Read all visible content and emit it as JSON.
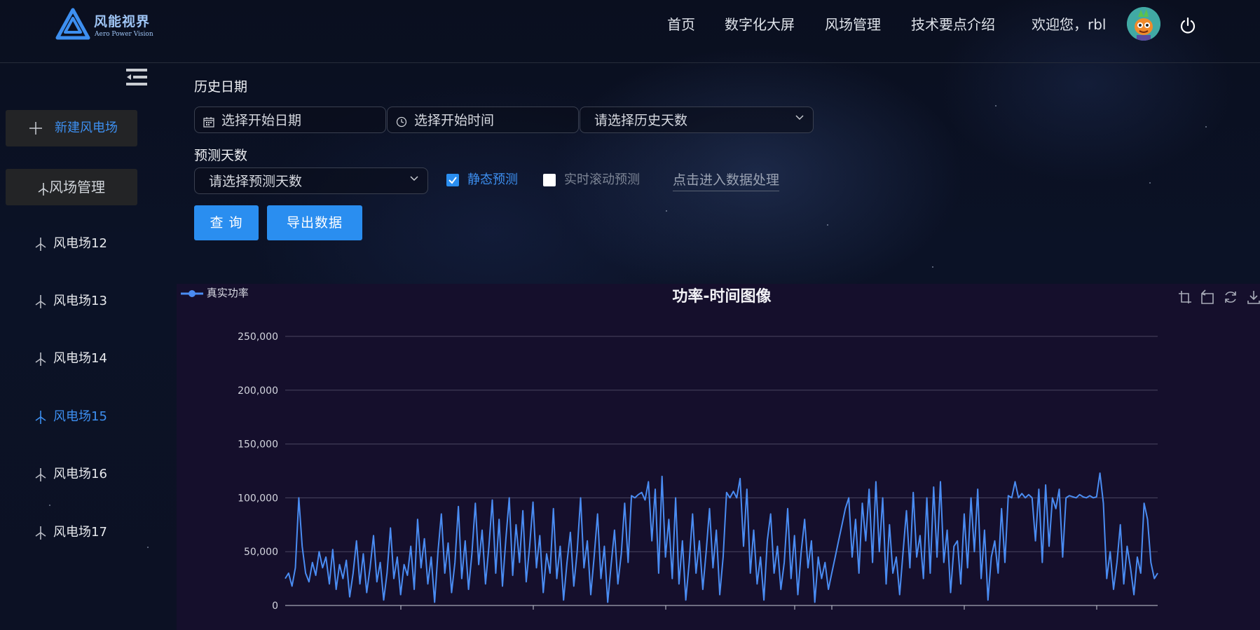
{
  "header": {
    "logo_title": "风能视界",
    "logo_subtitle": "Aero Power Vision",
    "nav": [
      "首页",
      "数字化大屏",
      "风场管理",
      "技术要点介绍"
    ],
    "welcome": "欢迎您，rbl",
    "avatar_icon": "avatar-cartoon",
    "power_icon": "power-icon"
  },
  "sidebar": {
    "new_button": "新建风电场",
    "mgmt_button": "风场管理",
    "items": [
      {
        "label": "风电场12",
        "active": false
      },
      {
        "label": "风电场13",
        "active": false
      },
      {
        "label": "风电场14",
        "active": false
      },
      {
        "label": "风电场15",
        "active": true
      },
      {
        "label": "风电场16",
        "active": false
      },
      {
        "label": "风电场17",
        "active": false
      }
    ]
  },
  "form": {
    "history_label": "历史日期",
    "start_date_placeholder": "选择开始日期",
    "start_time_placeholder": "选择开始时间",
    "history_days_placeholder": "请选择历史天数",
    "forecast_label": "预测天数",
    "forecast_days_placeholder": "请选择预测天数",
    "static_forecast": {
      "label": "静态预测",
      "checked": true
    },
    "rolling_forecast": {
      "label": "实时滚动预测",
      "checked": false
    },
    "data_link": "点击进入数据处理",
    "query_button": "查 询",
    "export_button": "导出数据"
  },
  "colors": {
    "accent": "#2a8ef0",
    "active": "#3d8ff0",
    "series": "#4a8cf2",
    "chart_bg": "#150f2c"
  },
  "chart_data": {
    "type": "line",
    "title": "功率-时间图像",
    "legend": [
      "真实功率"
    ],
    "legend_placement": "top-left",
    "ylim": [
      0,
      250000
    ],
    "yticks": [
      "0",
      "50,000",
      "100,000",
      "150,000",
      "200,000",
      "250,000"
    ],
    "grid": true,
    "series": [
      {
        "name": "真实功率",
        "values": [
          25000,
          30000,
          18000,
          35000,
          100000,
          55000,
          30000,
          22000,
          40000,
          28000,
          50000,
          35000,
          45000,
          20000,
          52000,
          15000,
          38000,
          25000,
          42000,
          8000,
          30000,
          60000,
          20000,
          48000,
          12000,
          35000,
          65000,
          22000,
          40000,
          5000,
          30000,
          72000,
          25000,
          45000,
          10000,
          38000,
          28000,
          55000,
          15000,
          80000,
          35000,
          62000,
          20000,
          45000,
          3000,
          50000,
          85000,
          30000,
          58000,
          12000,
          40000,
          92000,
          25000,
          60000,
          15000,
          48000,
          95000,
          38000,
          70000,
          20000,
          55000,
          98000,
          30000,
          80000,
          18000,
          62000,
          100000,
          28000,
          75000,
          40000,
          88000,
          22000,
          55000,
          96000,
          35000,
          65000,
          12000,
          48000,
          30000,
          90000,
          25000,
          55000,
          5000,
          40000,
          68000,
          18000,
          50000,
          100000,
          35000,
          60000,
          10000,
          45000,
          85000,
          25000,
          55000,
          3000,
          38000,
          70000,
          20000,
          48000,
          95000,
          40000,
          102000,
          100000,
          103000,
          105000,
          98000,
          115000,
          60000,
          108000,
          30000,
          120000,
          45000,
          80000,
          25000,
          100000,
          20000,
          60000,
          5000,
          40000,
          85000,
          30000,
          60000,
          15000,
          50000,
          90000,
          35000,
          70000,
          10000,
          45000,
          105000,
          100000,
          106000,
          100000,
          118000,
          55000,
          108000,
          30000,
          70000,
          20000,
          45000,
          5000,
          60000,
          85000,
          30000,
          55000,
          15000,
          40000,
          90000,
          25000,
          65000,
          10000,
          50000,
          80000,
          35000,
          60000,
          3000,
          45000,
          25000,
          40000,
          15000,
          30000,
          45000,
          60000,
          75000,
          90000,
          100000,
          45000,
          80000,
          30000,
          95000,
          60000,
          108000,
          40000,
          115000,
          50000,
          100000,
          20000,
          75000,
          30000,
          45000,
          10000,
          50000,
          88000,
          35000,
          105000,
          45000,
          65000,
          25000,
          100000,
          30000,
          110000,
          45000,
          115000,
          40000,
          70000,
          12000,
          55000,
          60000,
          20000,
          85000,
          35000,
          100000,
          50000,
          108000,
          25000,
          70000,
          5000,
          45000,
          60000,
          30000,
          90000,
          40000,
          102000,
          100000,
          115000,
          100000,
          104000,
          100000,
          103000,
          100000,
          60000,
          108000,
          40000,
          112000,
          55000,
          100000,
          90000,
          108000,
          45000,
          100000,
          102000,
          101000,
          100000,
          103000,
          101000,
          100000,
          102000,
          100000,
          101000,
          123000,
          95000,
          25000,
          50000,
          15000,
          40000,
          75000,
          20000,
          55000,
          35000,
          10000,
          45000,
          30000,
          95000,
          80000,
          40000,
          25000,
          30000
        ]
      }
    ]
  }
}
